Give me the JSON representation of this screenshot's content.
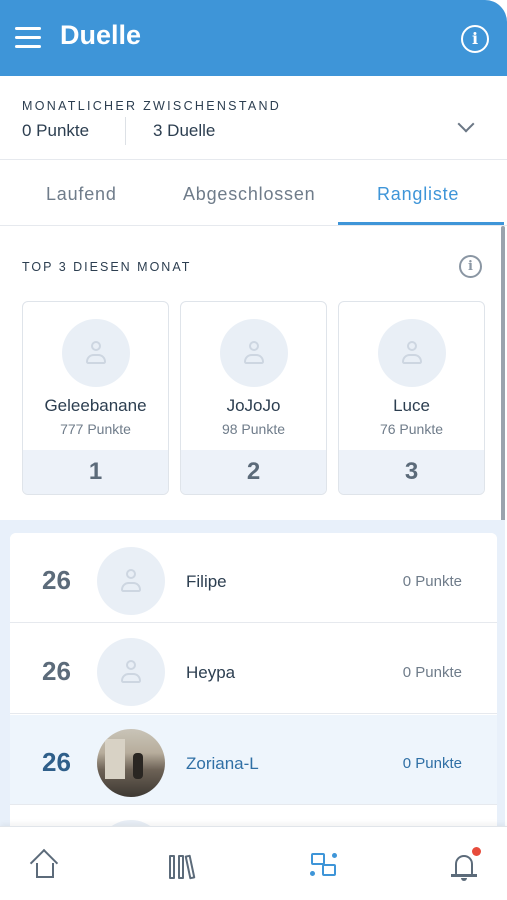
{
  "header": {
    "title": "Duelle"
  },
  "summary": {
    "label": "MONATLICHER ZWISCHENSTAND",
    "points": "0 Punkte",
    "duels": "3 Duelle"
  },
  "tabs": [
    {
      "label": "Laufend"
    },
    {
      "label": "Abgeschlossen"
    },
    {
      "label": "Rangliste",
      "active": true
    }
  ],
  "top3": {
    "label": "TOP 3 DIESEN MONAT",
    "players": [
      {
        "name": "Geleebanane",
        "points": "777 Punkte",
        "rank": "1"
      },
      {
        "name": "JoJoJo",
        "points": "98 Punkte",
        "rank": "2"
      },
      {
        "name": "Luce",
        "points": "76 Punkte",
        "rank": "3"
      }
    ]
  },
  "ranking": [
    {
      "rank": "26",
      "name": "Filipe",
      "points": "0 Punkte"
    },
    {
      "rank": "26",
      "name": "Heypa",
      "points": "0 Punkte"
    },
    {
      "rank": "26",
      "name": "Zoriana-L",
      "points": "0 Punkte",
      "current_user": true
    }
  ],
  "bottom_nav": [
    {
      "icon": "home-icon"
    },
    {
      "icon": "library-icon"
    },
    {
      "icon": "duel-icon",
      "active": true
    },
    {
      "icon": "bell-icon",
      "badge": true
    }
  ],
  "colors": {
    "accent": "#3e95d8",
    "badge": "#e74c3c"
  }
}
